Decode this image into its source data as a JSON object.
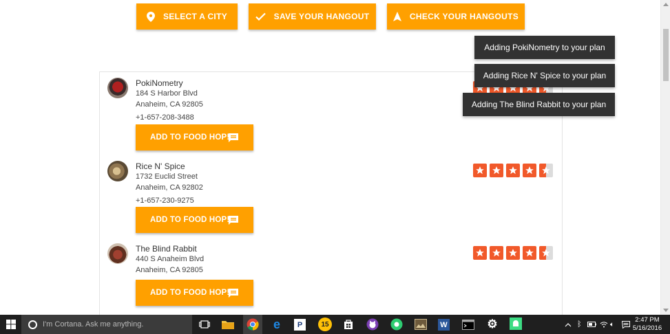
{
  "toolbar": {
    "select_city": "SELECT A CITY",
    "save_hangout": "SAVE YOUR HANGOUT",
    "check_hangouts": "CHECK YOUR HANGOUTS"
  },
  "venues": [
    {
      "name": "PokiNometry",
      "address1": "184 S Harbor Blvd",
      "address2": "Anaheim, CA 92805",
      "phone": "+1-657-208-3488",
      "button": "ADD TO FOOD HOP!",
      "rating": 4.5
    },
    {
      "name": "Rice N' Spice",
      "address1": "1732 Euclid Street",
      "address2": "Anaheim, CA 92802",
      "phone": "+1-657-230-9275",
      "button": "ADD TO FOOD HOP!",
      "rating": 4.5
    },
    {
      "name": "The Blind Rabbit",
      "address1": "440 S Anaheim Blvd",
      "address2": "Anaheim, CA 92805",
      "phone": "",
      "button": "ADD TO FOOD HOP!",
      "rating": 4.5
    }
  ],
  "toasts": [
    "Adding PokiNometry to your plan",
    "Adding Rice N' Spice to your plan",
    "Adding The Blind Rabbit to your plan"
  ],
  "taskbar": {
    "cortana_placeholder": "I'm Cortana. Ask me anything.",
    "time": "2:47 PM",
    "date": "5/16/2016",
    "badge_number": "15",
    "apps": [
      "task-view-icon",
      "file-explorer-icon",
      "chrome-icon",
      "edge-icon",
      "p-app-icon",
      "badge-app-icon",
      "store-icon",
      "cat-app-icon",
      "green-app-icon",
      "photo-app-icon",
      "word-icon",
      "terminal-icon",
      "settings-icon",
      "android-icon"
    ]
  },
  "colors": {
    "accent": "#ffa000",
    "star": "#f1592a",
    "toast_bg": "#323232",
    "taskbar_bg": "#1f1f1f"
  }
}
